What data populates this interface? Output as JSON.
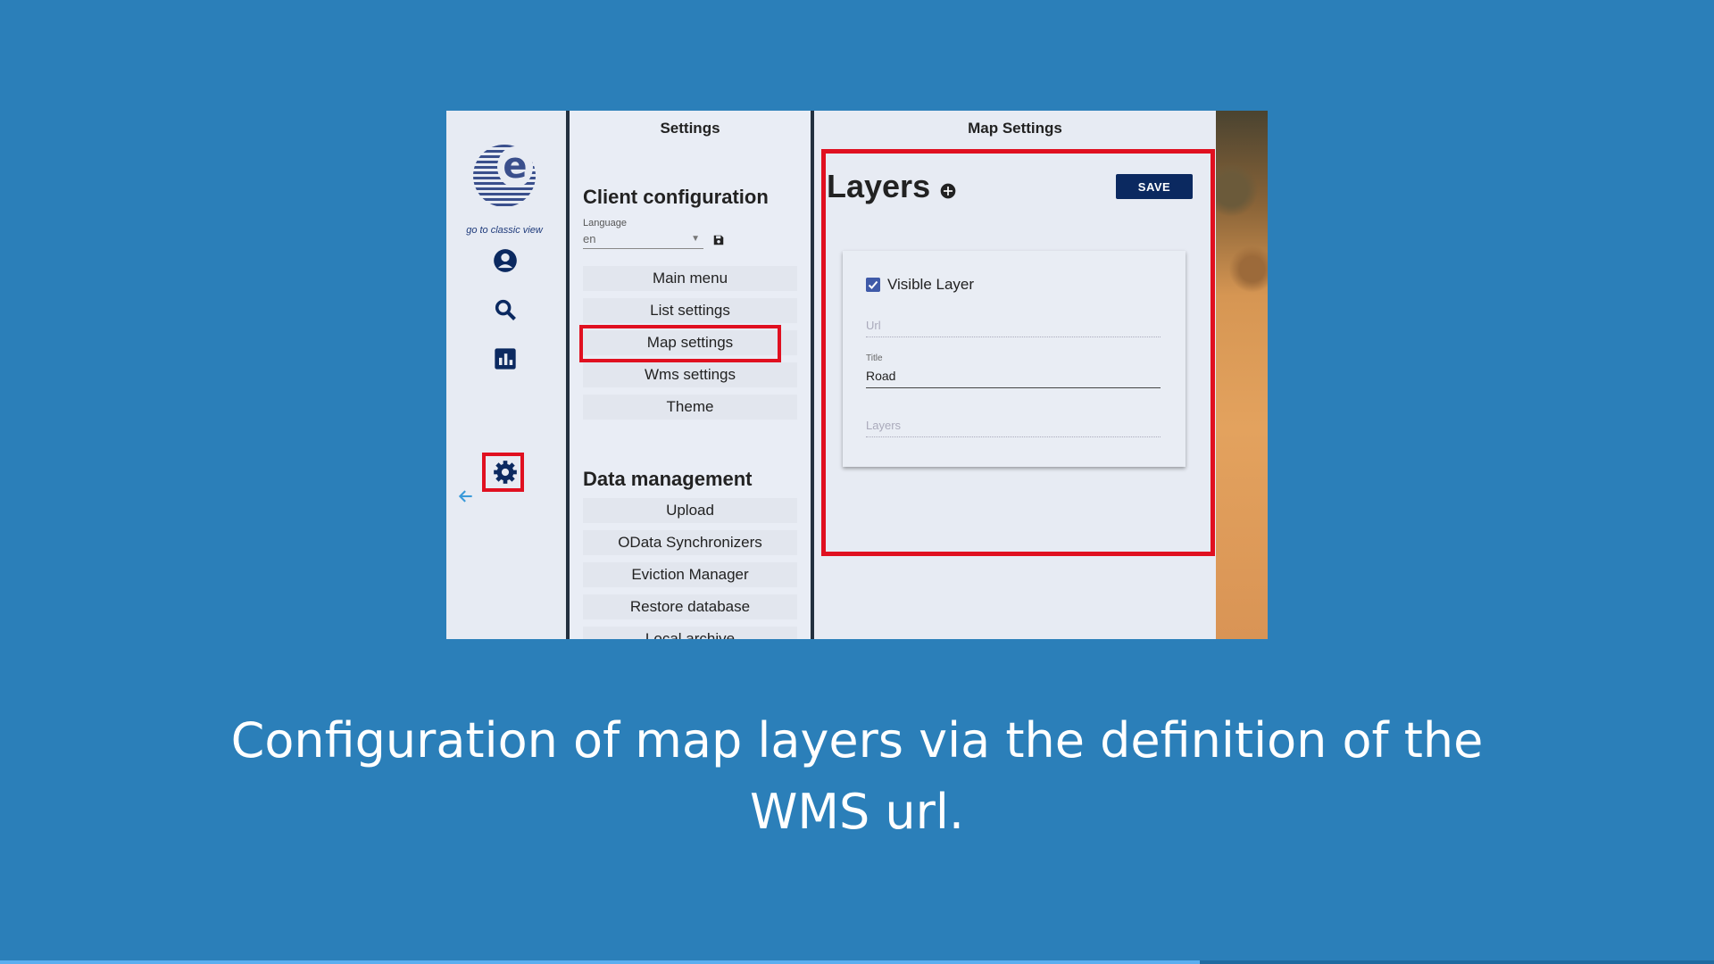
{
  "rail": {
    "classic_link": "go to classic view",
    "icons": [
      "user-icon",
      "search-icon",
      "chart-icon",
      "gear-icon",
      "back-arrow-icon"
    ]
  },
  "settings_panel": {
    "title": "Settings",
    "client_config_title": "Client configuration",
    "language_label": "Language",
    "language_value": "en",
    "client_items": [
      "Main menu",
      "List settings",
      "Map settings",
      "Wms settings",
      "Theme"
    ],
    "data_mgmt_title": "Data management",
    "data_items": [
      "Upload",
      "OData Synchronizers",
      "Eviction Manager",
      "Restore database",
      "Local archive"
    ]
  },
  "map_panel": {
    "title": "Map Settings",
    "layers_title": "Layers",
    "save_label": "SAVE",
    "layer": {
      "visible_label": "Visible Layer",
      "visible_checked": true,
      "url_placeholder": "Url",
      "title_label": "Title",
      "title_value": "Road",
      "layers_placeholder": "Layers"
    }
  },
  "caption": "Configuration of map layers via the definition of the WMS url.",
  "progress": 0.7,
  "colors": {
    "background": "#2b7fb9",
    "highlight": "#e01020",
    "save_button": "#0b2960",
    "icon": "#0b2960"
  }
}
